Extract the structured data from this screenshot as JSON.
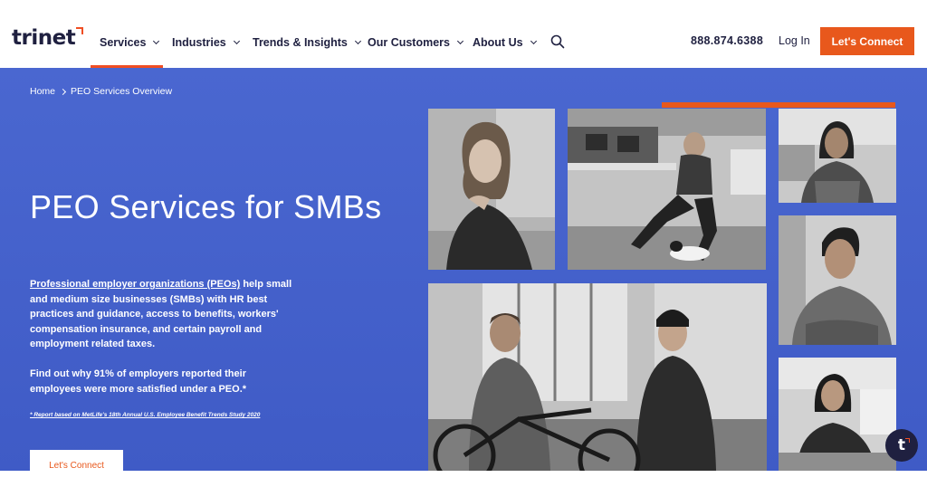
{
  "brand": {
    "logo_text": "trinet",
    "accent": "#f04e23",
    "hero_bg": "#4460cc",
    "cta": "#e8581c"
  },
  "nav": {
    "items": [
      {
        "label": "Services"
      },
      {
        "label": "Industries"
      },
      {
        "label": "Trends & Insights"
      },
      {
        "label": "Our Customers"
      },
      {
        "label": "About Us"
      }
    ],
    "active": "Services",
    "search_icon": "search-icon",
    "phone": "888.874.6388",
    "login": "Log In",
    "cta": "Let's Connect"
  },
  "breadcrumb": {
    "home": "Home",
    "current": "PEO Services Overview"
  },
  "hero": {
    "title": "PEO Services for SMBs",
    "desc_link": "Professional employer organizations (PEOs)",
    "desc_rest": " help small and medium size businesses (SMBs) with HR best practices and guidance, access to benefits, workers' compensation insurance, and certain payroll and employment related taxes.",
    "stat": "Find out why 91% of employers reported their employees were more satisfied under a PEO.*",
    "footnote": "* Report based on MetLife's 18th Annual U.S. Employee Benefit Trends Study 2020",
    "cta": "Let's Connect"
  },
  "photos": [
    {
      "name": "woman-portrait-photo"
    },
    {
      "name": "office-man-with-dog-photo"
    },
    {
      "name": "woman-smiling-photo"
    },
    {
      "name": "man-smiling-photo"
    },
    {
      "name": "two-men-with-bike-photo"
    },
    {
      "name": "woman-at-desk-photo"
    }
  ],
  "chat": {
    "icon": "chat-launcher-icon",
    "glyph": "t"
  }
}
